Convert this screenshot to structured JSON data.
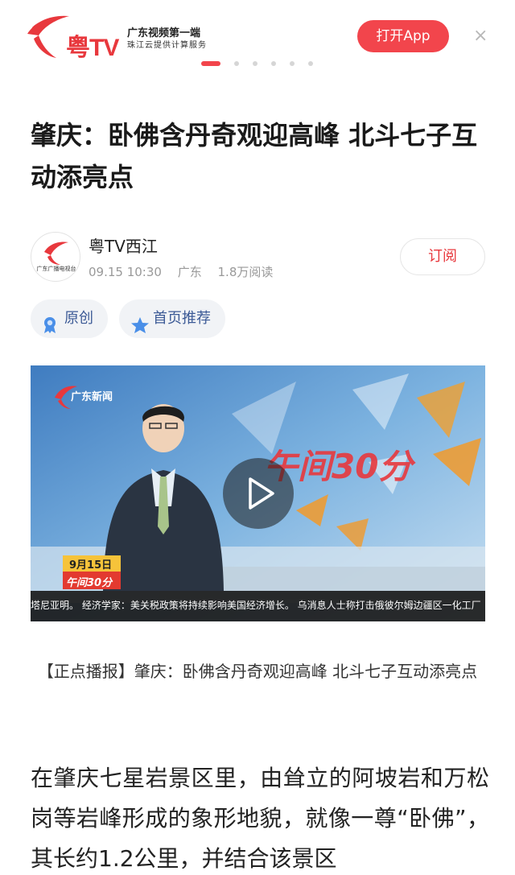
{
  "banner": {
    "logo_text": "粤TV",
    "brand_line1": "广东视频第一端",
    "brand_line2": "珠江云提供计算服务",
    "open_app_label": "打开App",
    "close_glyph": "×",
    "carousel_count": 6,
    "carousel_active": 0
  },
  "article": {
    "title": "肇庆：卧佛含丹奇观迎高峰 北斗七子互动添亮点",
    "author": {
      "name": "粤TV西江",
      "avatar_text": "广东广播电视台",
      "time": "09.15 10:30",
      "region": "广东",
      "reads": "1.8万阅读"
    },
    "subscribe_label": "订阅",
    "tags": [
      {
        "label": "原创",
        "icon": "original-badge-icon"
      },
      {
        "label": "首页推荐",
        "icon": "star-recommend-icon"
      }
    ],
    "video": {
      "channel_logo": "广东新闻",
      "program_name": "午间30分",
      "date_badge": "9月15日",
      "ticker_text": "塔尼亚明。  经济学家：美关税政策将持续影响美国经济增长。  乌消息人士称打击俄彼尔姆边疆区一化工厂"
    },
    "caption": "【正点播报】肇庆：卧佛含丹奇观迎高峰 北斗七子互动添亮点",
    "body_paragraph": "在肇庆七星岩景区里，由耸立的阿坡岩和万松岗等岩峰形成的象形地貌，就像一尊“卧佛”，其长约1.2公里，并结合该景区"
  },
  "colors": {
    "brand_red": "#f2454c",
    "tag_text": "#3c5a96",
    "tag_bg": "#f1f3f6",
    "meta_gray": "#999999"
  }
}
